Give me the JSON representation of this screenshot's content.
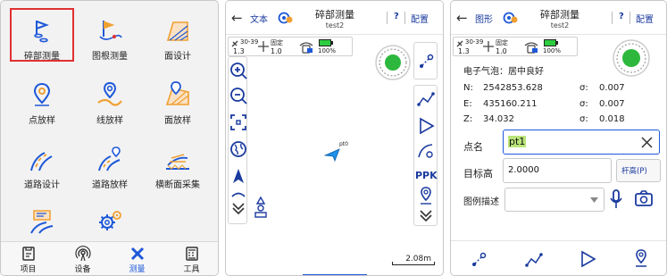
{
  "panel1": {
    "tiles": [
      {
        "label": "碎部测量",
        "icon": "survey-flag-icon"
      },
      {
        "label": "图根测量",
        "icon": "control-flag-icon"
      },
      {
        "label": "面设计",
        "icon": "area-design-icon"
      },
      {
        "label": "点放样",
        "icon": "point-stakeout-icon"
      },
      {
        "label": "线放样",
        "icon": "line-stakeout-icon"
      },
      {
        "label": "面放样",
        "icon": "area-stakeout-icon"
      },
      {
        "label": "道路设计",
        "icon": "road-design-icon"
      },
      {
        "label": "道路放样",
        "icon": "road-stakeout-icon"
      },
      {
        "label": "横断面采集",
        "icon": "cross-section-icon"
      },
      {
        "label": "",
        "icon": "road-misc-icon"
      },
      {
        "label": "",
        "icon": "settings-gears-icon"
      }
    ],
    "tabs": [
      {
        "label": "项目",
        "icon": "project-icon"
      },
      {
        "label": "设备",
        "icon": "device-icon"
      },
      {
        "label": "测量",
        "icon": "measure-icon"
      },
      {
        "label": "工具",
        "icon": "tools-icon"
      }
    ],
    "active_tab": "测量",
    "colors": {
      "accent": "#1e58d8",
      "icon_orange": "#f0a030",
      "selected_outline": "#e03030"
    }
  },
  "panel2": {
    "header": {
      "back": "←",
      "mode_label": "文本",
      "title": "碎部测量",
      "subtitle": "test2",
      "help": "?",
      "config": "配置"
    },
    "status": {
      "sats": "30-39",
      "sats_val": "1.3",
      "fix": "固定",
      "fix_val": "1.0",
      "battery": "100%"
    },
    "map": {
      "point_label": "pt0",
      "scale": "2.08m",
      "ppk": "PPK"
    }
  },
  "panel3": {
    "header": {
      "back": "←",
      "mode_label": "图形",
      "title": "碎部测量",
      "subtitle": "test2",
      "help": "?",
      "config": "配置"
    },
    "status": {
      "sats": "30-39",
      "sats_val": "1.3",
      "fix": "固定",
      "fix_val": "1.0",
      "battery": "100%"
    },
    "bubble": "电子气泡：居中良好",
    "coords": [
      {
        "label": "N:",
        "value": "2542853.628",
        "sigma": "σ:",
        "sigma_val": "0.007"
      },
      {
        "label": "E:",
        "value": "435160.211",
        "sigma": "σ:",
        "sigma_val": "0.007"
      },
      {
        "label": "Z:",
        "value": "34.032",
        "sigma": "σ:",
        "sigma_val": "0.018"
      }
    ],
    "point_name_label": "点名",
    "point_name_value": "pt1",
    "target_height_label": "目标高",
    "target_height_value": "2.0000",
    "pole_height_button": "杆高(P)",
    "legend_label": "图例描述",
    "legend_value": ""
  }
}
